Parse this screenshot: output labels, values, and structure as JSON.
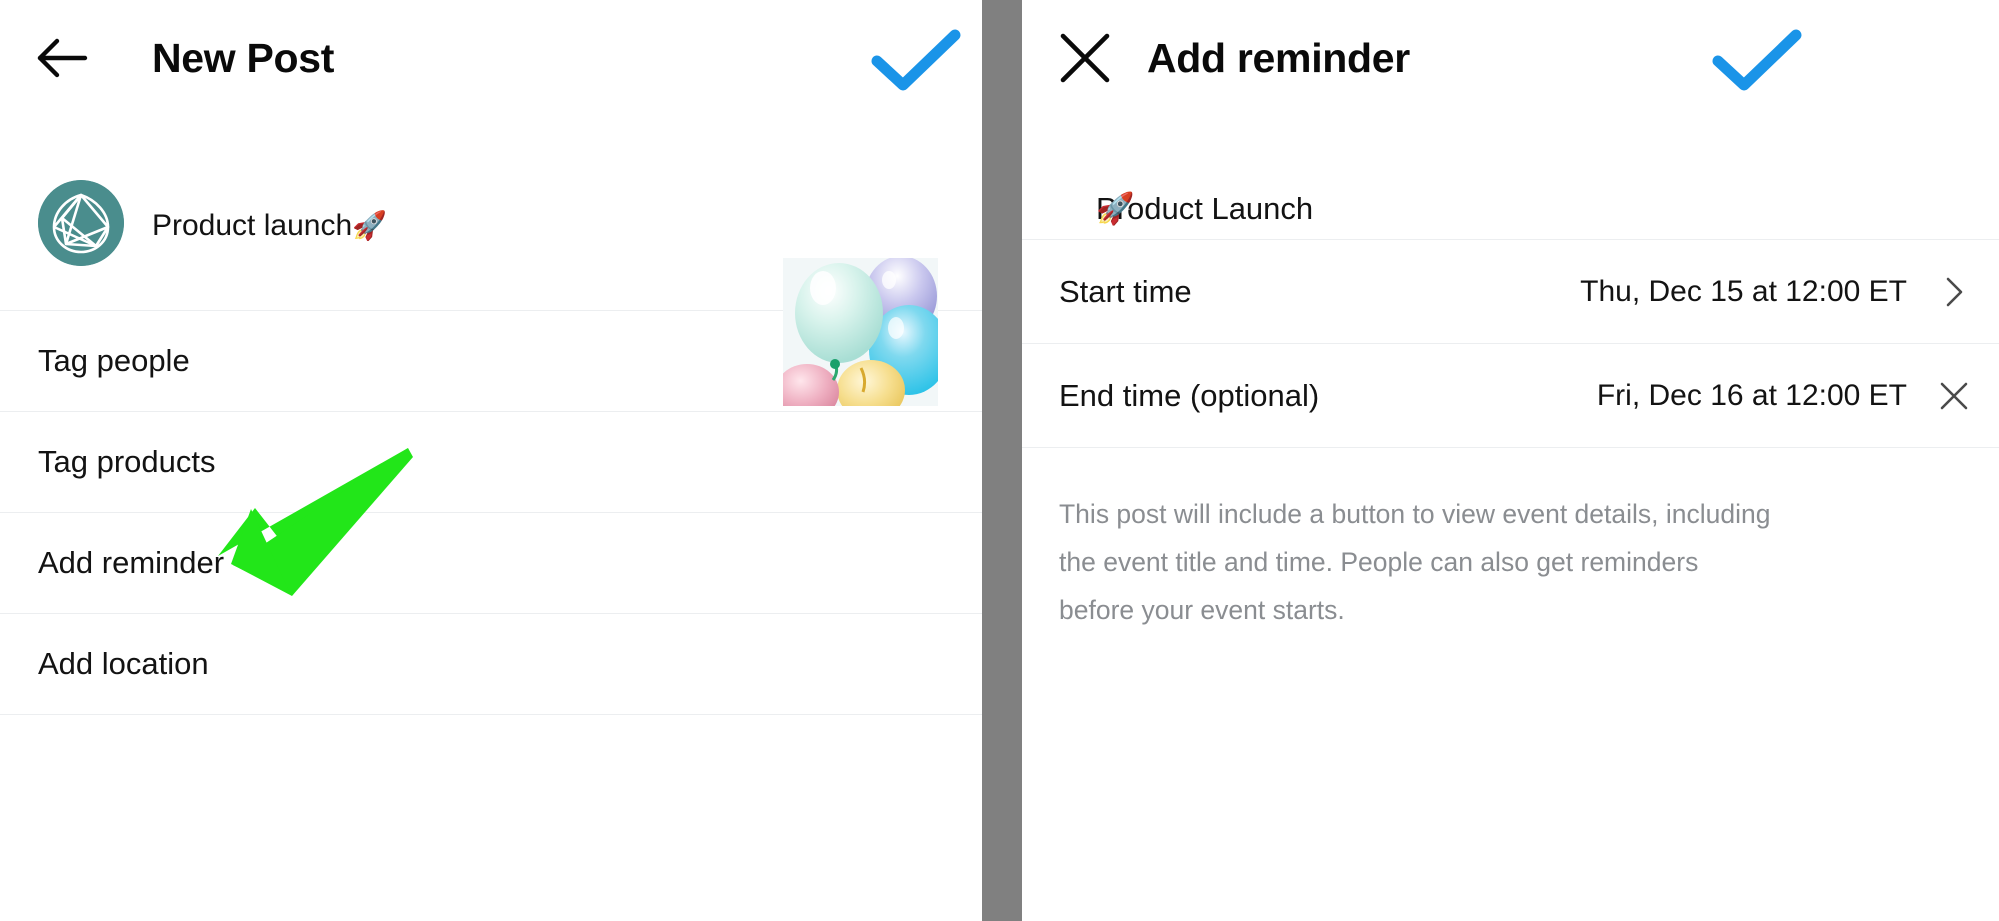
{
  "colors": {
    "accent_blue": "#1a94e8",
    "annotation_green": "#22e619",
    "avatar_teal": "#4a8d8d",
    "divider_gray": "#eceef0",
    "gutter_gray": "#808080",
    "text_primary": "#131313",
    "text_secondary": "#8a8d91"
  },
  "left_panel": {
    "header": {
      "back_icon": "back-arrow-icon",
      "title": "New Post",
      "confirm_icon": "checkmark-icon"
    },
    "caption": {
      "avatar_icon": "profile-avatar-icon",
      "text": "Product launch",
      "emoji": "🚀",
      "thumbnail_icon": "post-thumbnail-balloons"
    },
    "rows": [
      {
        "label": "Tag people"
      },
      {
        "label": "Tag products"
      },
      {
        "label": "Add reminder"
      },
      {
        "label": "Add location"
      }
    ],
    "annotation": {
      "icon": "green-arrow-annotation",
      "points_to": "Add reminder"
    }
  },
  "right_panel": {
    "header": {
      "close_icon": "close-x-icon",
      "title": "Add reminder",
      "confirm_icon": "checkmark-icon"
    },
    "event_title": {
      "text": "Product Launch",
      "emoji": "🚀"
    },
    "rows": [
      {
        "label": "Start time",
        "value": "Thu, Dec 15 at 12:00 ET",
        "affordance": "chevron-right-icon"
      },
      {
        "label": "End time (optional)",
        "value": "Fri, Dec 16 at 12:00 ET",
        "affordance": "clear-x-icon"
      }
    ],
    "note": "This post will include a button to view event details, including the event title and time. People can also get reminders before your event starts."
  }
}
